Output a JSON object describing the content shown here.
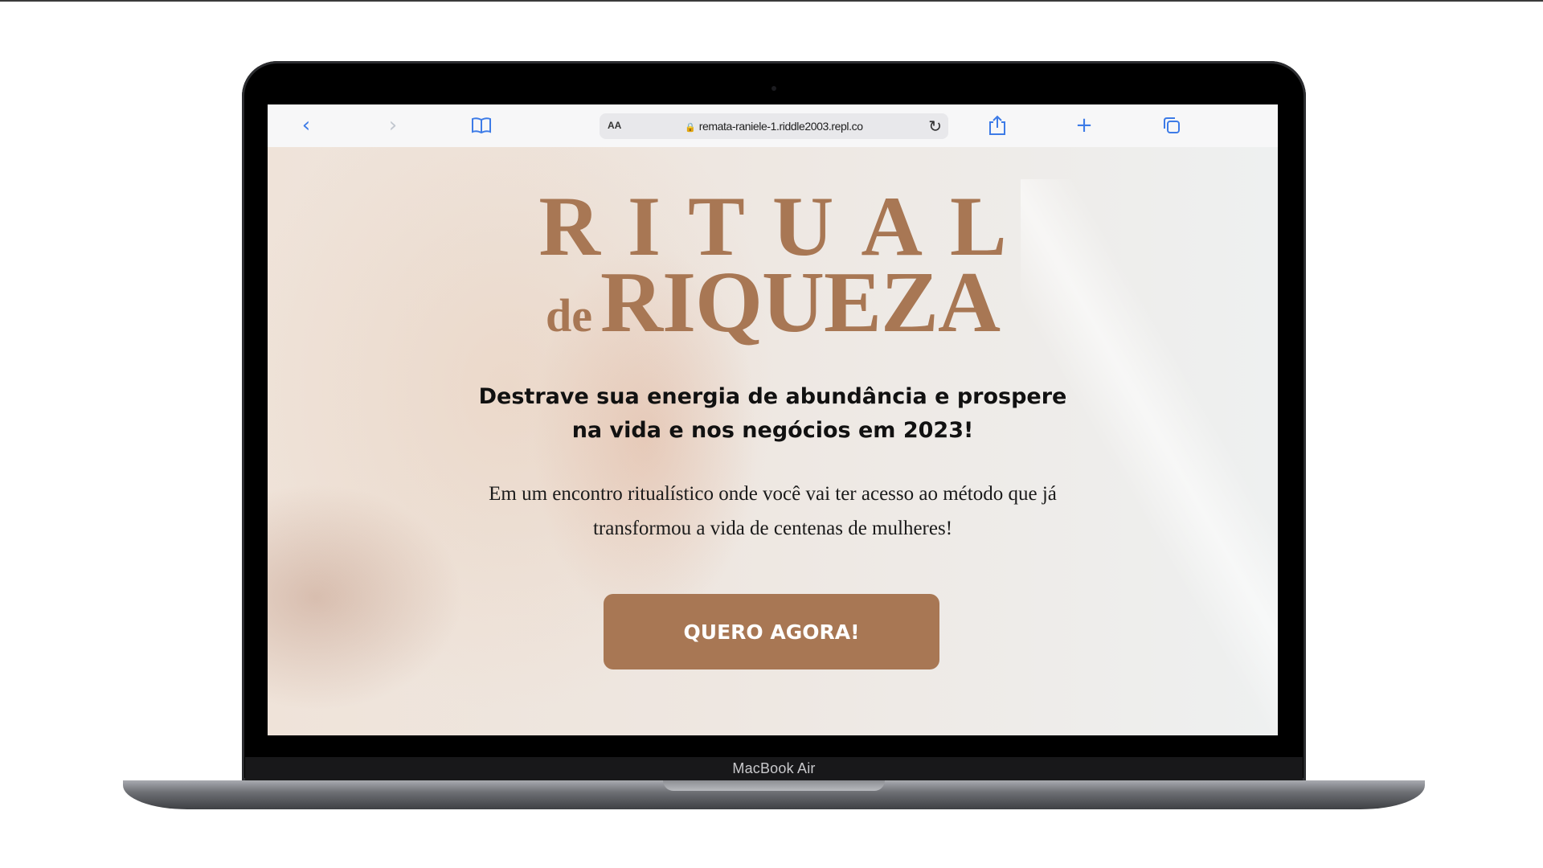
{
  "device": {
    "label": "MacBook Air"
  },
  "browser": {
    "text_size_button": "AA",
    "url": "remata-raniele-1.riddle2003.repl.co"
  },
  "hero": {
    "title_line1": "RITUAL",
    "title_de": "de",
    "title_line2": "RIQUEZA",
    "headline_line1": "Destrave sua energia de abundância e prospere",
    "headline_line2": "na vida e nos negócios em 2023!",
    "subtext_line1": "Em um encontro ritualístico onde você vai ter acesso ao método que já",
    "subtext_line2": "transformou a vida de centenas de mulheres!",
    "cta_label": "QUERO AGORA!"
  },
  "colors": {
    "accent": "#a87754",
    "link_blue": "#3d7be7"
  },
  "icons": {
    "back": "chevron-left-icon",
    "forward": "chevron-right-icon",
    "bookmarks": "book-icon",
    "lock": "lock-icon",
    "reload": "reload-icon",
    "share": "share-icon",
    "new_tab": "plus-icon",
    "tabs": "tabs-icon"
  }
}
